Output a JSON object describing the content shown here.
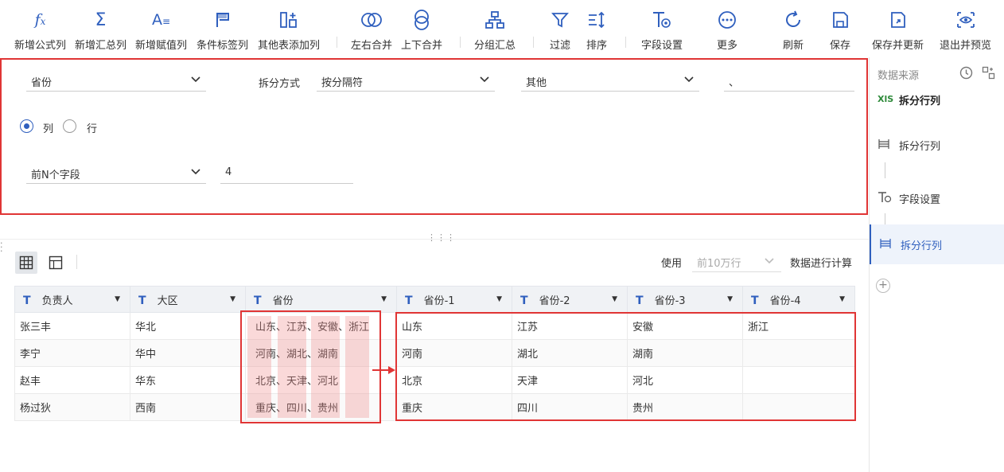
{
  "toolbar": {
    "items": [
      {
        "label": "新增公式列",
        "icon": "fx-icon"
      },
      {
        "label": "新增汇总列",
        "icon": "sigma-icon"
      },
      {
        "label": "新增赋值列",
        "icon": "assign-icon"
      },
      {
        "label": "条件标签列",
        "icon": "flag-icon"
      },
      {
        "label": "其他表添加列",
        "icon": "add-column-icon"
      },
      {
        "label": "左右合并",
        "icon": "merge-lr-icon"
      },
      {
        "label": "上下合并",
        "icon": "merge-tb-icon"
      },
      {
        "label": "分组汇总",
        "icon": "group-icon"
      },
      {
        "label": "过滤",
        "icon": "filter-icon"
      },
      {
        "label": "排序",
        "icon": "sort-icon"
      },
      {
        "label": "字段设置",
        "icon": "field-settings-icon"
      },
      {
        "label": "更多",
        "icon": "more-icon"
      },
      {
        "label": "刷新",
        "icon": "refresh-icon"
      },
      {
        "label": "保存",
        "icon": "save-icon"
      },
      {
        "label": "保存并更新",
        "icon": "save-update-icon"
      },
      {
        "label": "退出并预览",
        "icon": "preview-icon"
      }
    ]
  },
  "config": {
    "field_select": "省份",
    "split_method_label": "拆分方式",
    "split_method_value": "按分隔符",
    "separator_type": "其他",
    "separator_value": "、",
    "radio_col": "列",
    "radio_row": "行",
    "radio_selected": "列",
    "topn_select": "前N个字段",
    "topn_value": "4"
  },
  "preview": {
    "use_label": "使用",
    "use_select": "前10万行",
    "use_suffix": "数据进行计算"
  },
  "table": {
    "columns": [
      "负责人",
      "大区",
      "省份",
      "省份-1",
      "省份-2",
      "省份-3",
      "省份-4"
    ],
    "rows": [
      [
        "张三丰",
        "华北",
        "山东、江苏、安徽、浙江",
        "山东",
        "江苏",
        "安徽",
        "浙江"
      ],
      [
        "李宁",
        "华中",
        "河南、湖北、湖南",
        "河南",
        "湖北",
        "湖南",
        ""
      ],
      [
        "赵丰",
        "华东",
        "北京、天津、河北",
        "北京",
        "天津",
        "河北",
        ""
      ],
      [
        "杨过狄",
        "西南",
        "重庆、四川、贵州",
        "重庆",
        "四川",
        "贵州",
        ""
      ]
    ]
  },
  "sidebar": {
    "title": "数据来源",
    "steps": [
      {
        "label": "拆分行列",
        "icon": "xls-icon"
      },
      {
        "label": "拆分行列",
        "icon": "split-icon"
      },
      {
        "label": "字段设置",
        "icon": "field-settings-icon"
      },
      {
        "label": "拆分行列",
        "icon": "split-icon"
      }
    ]
  },
  "colors": {
    "accent": "#2f5fbe",
    "highlight": "#e03535"
  }
}
